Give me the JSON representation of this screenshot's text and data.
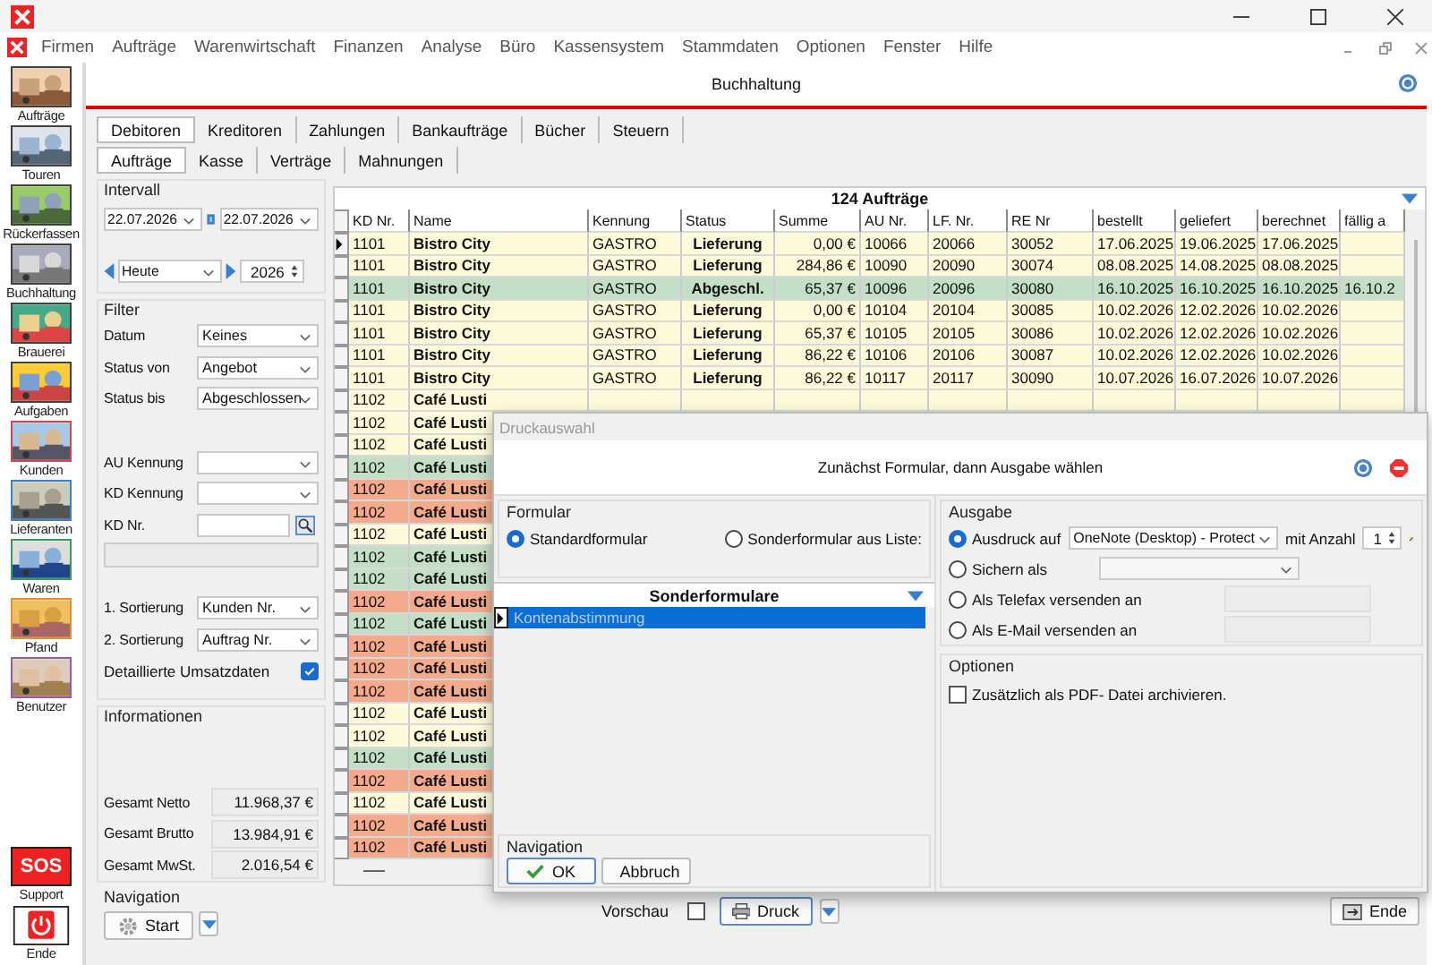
{
  "menu": [
    "Firmen",
    "Aufträge",
    "Warenwirtschaft",
    "Finanzen",
    "Analyse",
    "Büro",
    "Kassensystem",
    "Stammdaten",
    "Optionen",
    "Fenster",
    "Hilfe"
  ],
  "sidebar": [
    {
      "label": "Aufträge",
      "color": "#404040"
    },
    {
      "label": "Touren",
      "color": "#404040"
    },
    {
      "label": "Rückerfassen",
      "color": "#404040"
    },
    {
      "label": "Buchhaltung",
      "color": "#404040"
    },
    {
      "label": "Brauerei",
      "color": "#404040"
    },
    {
      "label": "Aufgaben",
      "color": "#404040"
    },
    {
      "label": "Kunden",
      "color": "#d04848"
    },
    {
      "label": "Lieferanten",
      "color": "#3a80d0"
    },
    {
      "label": "Waren",
      "color": "#3a9a58"
    },
    {
      "label": "Pfand",
      "color": "#e0903a"
    },
    {
      "label": "Benutzer",
      "color": "#9a5aa8"
    }
  ],
  "sidebar_bottom": [
    {
      "kind": "sos",
      "badge": "SOS",
      "label": "Support"
    },
    {
      "kind": "power",
      "label": "Ende"
    }
  ],
  "header": {
    "title": "Buchhaltung"
  },
  "tabs": [
    {
      "label": "Debitoren",
      "selected": true
    },
    {
      "label": "Kreditoren",
      "selected": false
    },
    {
      "label": "Zahlungen",
      "selected": false
    },
    {
      "label": "Bankaufträge",
      "selected": false
    },
    {
      "label": "Bücher",
      "selected": false
    },
    {
      "label": "Steuern",
      "selected": false
    }
  ],
  "subtabs": [
    {
      "label": "Aufträge",
      "selected": true
    },
    {
      "label": "Kasse",
      "selected": false
    },
    {
      "label": "Verträge",
      "selected": false
    },
    {
      "label": "Mahnungen",
      "selected": false
    }
  ],
  "interval": {
    "label": "Intervall",
    "from": "22.07.2026",
    "to": "22.07.2026",
    "period": "Heute",
    "year": "2026"
  },
  "filter": {
    "label": "Filter",
    "top_fields": [
      {
        "label": "Datum",
        "value": "Keines"
      },
      {
        "label": "Status von",
        "value": "Angebot"
      },
      {
        "label": "Status bis",
        "value": "Abgeschlossen"
      }
    ],
    "id_fields": [
      {
        "label": "AU Kennung"
      },
      {
        "label": "KD Kennung"
      }
    ],
    "kd_nr": {
      "label": "KD Nr."
    },
    "sort_fields": [
      {
        "label": "1. Sortierung",
        "value": "Kunden Nr."
      },
      {
        "label": "2. Sortierung",
        "value": "Auftrag Nr."
      }
    ],
    "detailed": {
      "label": "Detaillierte Umsatzdaten",
      "checked": true
    }
  },
  "info": {
    "label": "Informationen",
    "totals": [
      {
        "label": "Gesamt Netto",
        "value": "11.968,37 €"
      },
      {
        "label": "Gesamt Brutto",
        "value": "13.984,91 €"
      },
      {
        "label": "Gesamt MwSt.",
        "value": "2.016,54 €"
      }
    ]
  },
  "navigation": {
    "label": "Navigation",
    "start": "Start"
  },
  "grid": {
    "title": "124 Aufträge",
    "columns": [
      "KD Nr.",
      "Name",
      "Kennung",
      "Status",
      "Summe",
      "AU Nr.",
      "LF. Nr.",
      "RE Nr",
      "bestellt",
      "geliefert",
      "berechnet",
      "fällig a"
    ],
    "rows": [
      {
        "selected": true,
        "color": "#fcfad8",
        "cells": [
          "1101",
          "Bistro City",
          "GASTRO",
          "Lieferung",
          "0,00 €",
          "10066",
          "20066",
          "30052",
          "17.06.2025",
          "19.06.2025",
          "17.06.2025"
        ]
      },
      {
        "selected": false,
        "color": "#fcfad8",
        "cells": [
          "1101",
          "Bistro City",
          "GASTRO",
          "Lieferung",
          "284,86 €",
          "10090",
          "20090",
          "30074",
          "08.08.2025",
          "14.08.2025",
          "08.08.2025"
        ]
      },
      {
        "selected": false,
        "color": "#c3dfc6",
        "cells": [
          "1101",
          "Bistro City",
          "GASTRO",
          "Abgeschl.",
          "65,37 €",
          "10096",
          "20096",
          "30080",
          "16.10.2025",
          "16.10.2025",
          "16.10.2025",
          "16.10.2"
        ]
      },
      {
        "selected": false,
        "color": "#fcfad8",
        "cells": [
          "1101",
          "Bistro City",
          "GASTRO",
          "Lieferung",
          "0,00 €",
          "10104",
          "20104",
          "30085",
          "10.02.2026",
          "12.02.2026",
          "10.02.2026"
        ]
      },
      {
        "selected": false,
        "color": "#fcfad8",
        "cells": [
          "1101",
          "Bistro City",
          "GASTRO",
          "Lieferung",
          "65,37 €",
          "10105",
          "20105",
          "30086",
          "10.02.2026",
          "12.02.2026",
          "10.02.2026"
        ]
      },
      {
        "selected": false,
        "color": "#fcfad8",
        "cells": [
          "1101",
          "Bistro City",
          "GASTRO",
          "Lieferung",
          "86,22 €",
          "10106",
          "20106",
          "30087",
          "10.02.2026",
          "12.02.2026",
          "10.02.2026"
        ]
      },
      {
        "selected": false,
        "color": "#fcfad8",
        "cells": [
          "1101",
          "Bistro City",
          "GASTRO",
          "Lieferung",
          "86,22 €",
          "10117",
          "20117",
          "30090",
          "10.07.2026",
          "16.07.2026",
          "10.07.2026"
        ]
      },
      {
        "selected": false,
        "color": "#fcfad8",
        "cells": [
          "1102",
          "Café Lusti"
        ]
      },
      {
        "selected": false,
        "color": "#fcfad8",
        "cells": [
          "1102",
          "Café Lusti"
        ]
      },
      {
        "selected": false,
        "color": "#fcfad8",
        "cells": [
          "1102",
          "Café Lusti"
        ]
      },
      {
        "selected": false,
        "color": "#c3dfc6",
        "cells": [
          "1102",
          "Café Lusti"
        ]
      },
      {
        "selected": false,
        "color": "#f4aa8c",
        "cells": [
          "1102",
          "Café Lusti"
        ]
      },
      {
        "selected": false,
        "color": "#f4aa8c",
        "cells": [
          "1102",
          "Café Lusti"
        ]
      },
      {
        "selected": false,
        "color": "#fcfad8",
        "cells": [
          "1102",
          "Café Lusti"
        ]
      },
      {
        "selected": false,
        "color": "#c3dfc6",
        "cells": [
          "1102",
          "Café Lusti"
        ]
      },
      {
        "selected": false,
        "color": "#c3dfc6",
        "cells": [
          "1102",
          "Café Lusti"
        ]
      },
      {
        "selected": false,
        "color": "#f4aa8c",
        "cells": [
          "1102",
          "Café Lusti"
        ]
      },
      {
        "selected": false,
        "color": "#c3dfc6",
        "cells": [
          "1102",
          "Café Lusti"
        ]
      },
      {
        "selected": false,
        "color": "#f4aa8c",
        "cells": [
          "1102",
          "Café Lusti"
        ]
      },
      {
        "selected": false,
        "color": "#f4aa8c",
        "cells": [
          "1102",
          "Café Lusti"
        ]
      },
      {
        "selected": false,
        "color": "#f4aa8c",
        "cells": [
          "1102",
          "Café Lusti"
        ]
      },
      {
        "selected": false,
        "color": "#fcfad8",
        "cells": [
          "1102",
          "Café Lusti"
        ]
      },
      {
        "selected": false,
        "color": "#fcfad8",
        "cells": [
          "1102",
          "Café Lusti"
        ]
      },
      {
        "selected": false,
        "color": "#c3dfc6",
        "cells": [
          "1102",
          "Café Lusti"
        ]
      },
      {
        "selected": false,
        "color": "#f4aa8c",
        "cells": [
          "1102",
          "Café Lusti"
        ]
      },
      {
        "selected": false,
        "color": "#fcfad8",
        "cells": [
          "1102",
          "Café Lusti"
        ]
      },
      {
        "selected": false,
        "color": "#f4aa8c",
        "cells": [
          "1102",
          "Café Lusti"
        ]
      },
      {
        "selected": false,
        "color": "#f4aa8c",
        "cells": [
          "1102",
          "Café Lusti"
        ]
      }
    ]
  },
  "footer": {
    "preview_label": "Vorschau",
    "preview_checked": false,
    "print": "Druck",
    "end": "Ende"
  },
  "dialog": {
    "title": "Druckauswahl",
    "message": "Zunächst Formular, dann Ausgabe wählen",
    "form_label": "Formular",
    "form_options": [
      {
        "label": "Standardformular",
        "selected": true
      },
      {
        "label": "Sonderformular aus Liste:",
        "selected": false
      }
    ],
    "list_title": "Sonderformulare",
    "list_items": [
      {
        "label": "Kontenabstimmung",
        "selected": true
      }
    ],
    "output_label": "Ausgabe",
    "outputs": [
      {
        "kind": "printer",
        "label": "Ausdruck auf",
        "selected": true,
        "value": "OneNote (Desktop) - Protect",
        "count_label": "mit Anzahl",
        "count": "1"
      },
      {
        "kind": "select",
        "label": "Sichern als",
        "selected": false
      },
      {
        "kind": "text",
        "label": "Als Telefax versenden an",
        "selected": false
      },
      {
        "kind": "text",
        "label": "Als E-Mail versenden an",
        "selected": false
      }
    ],
    "options_label": "Optionen",
    "pdf": {
      "label": "Zusätzlich als PDF- Datei archivieren.",
      "checked": false
    },
    "nav_label": "Navigation",
    "ok": "OK",
    "cancel": "Abbruch"
  }
}
